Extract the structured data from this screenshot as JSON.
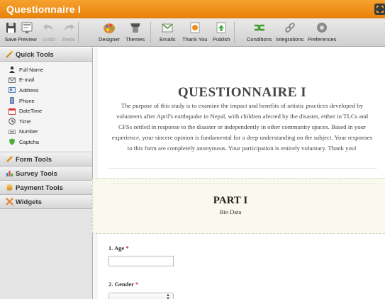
{
  "app": {
    "title": "Questionnaire I"
  },
  "toolbar": {
    "save": "Save",
    "preview": "Preview",
    "undo": "Undo",
    "redo": "Redo",
    "designer": "Designer",
    "themes": "Themes",
    "emails": "Emails",
    "thank_you": "Thank You",
    "publish": "Publish",
    "conditions": "Conditions",
    "integrations": "Integrations",
    "preferences": "Preferences"
  },
  "sidebar": {
    "quick_tools": "Quick Tools",
    "quick_items": [
      {
        "label": "Full Name",
        "icon": "person-icon"
      },
      {
        "label": "E-mail",
        "icon": "envelope-icon"
      },
      {
        "label": "Address",
        "icon": "address-card-icon"
      },
      {
        "label": "Phone",
        "icon": "phone-icon"
      },
      {
        "label": "DateTime",
        "icon": "calendar-icon"
      },
      {
        "label": "Time",
        "icon": "clock-icon"
      },
      {
        "label": "Number",
        "icon": "number-icon"
      },
      {
        "label": "Captcha",
        "icon": "shield-icon"
      }
    ],
    "form_tools": "Form Tools",
    "survey_tools": "Survey Tools",
    "payment_tools": "Payment Tools",
    "widgets": "Widgets"
  },
  "form": {
    "title": "QUESTIONNAIRE I",
    "description": "The purpose of this study is to examine the impact and benefits of artistic practices developed by volunteers after April's earthquake in Nepal, with children afected by the disaster, either in TLCs and CFSs settled in response to the disaster or independently in other community spaces. Based in your experience, your sincere opinion is fundamental for a deep understanding on the subject. Your responses to this form are completely anonymous. Your participation is entirely voluntary. Thank you!",
    "part_title": "PART I",
    "part_subtitle": "Bio Data",
    "q1_label": "1. Age",
    "q1_value": "",
    "q2_label": "2. Gender",
    "required_mark": "*"
  },
  "colors": {
    "accent": "#f39019",
    "required": "#d42020"
  }
}
